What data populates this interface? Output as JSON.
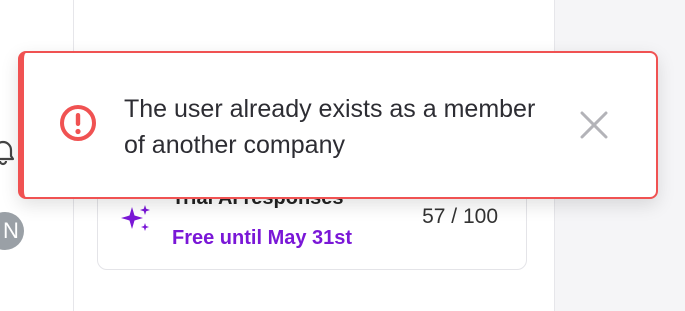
{
  "sidebar": {
    "icons": [
      "bell-icon"
    ],
    "avatar_initial": "N"
  },
  "usage_card": {
    "title": "Trial AI responses",
    "promo": "Free until May 31st",
    "count": "57 / 100",
    "icon": "sparkle-icon"
  },
  "toast": {
    "message": "The user already exists as a member of another company",
    "icon": "alert-circle-icon",
    "close_icon": "close-icon",
    "accent_color": "#f05252"
  },
  "colors": {
    "error": "#f05252",
    "promo": "#7a17d7"
  }
}
